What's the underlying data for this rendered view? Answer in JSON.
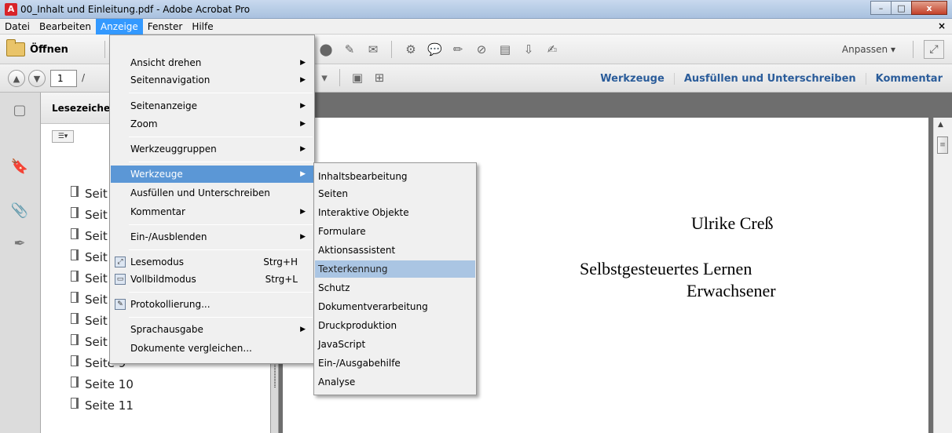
{
  "window": {
    "title": "00_Inhalt und Einleitung.pdf - Adobe Acrobat Pro",
    "minimize": "–",
    "maximize": "□",
    "close": "x"
  },
  "menubar": {
    "items": [
      "Datei",
      "Bearbeiten",
      "Anzeige",
      "Fenster",
      "Hilfe"
    ],
    "active": "Anzeige",
    "close_doc": "×"
  },
  "toolbar": {
    "open_label": "Öffnen",
    "anpassen_label": "Anpassen"
  },
  "navbar": {
    "page_value": "1",
    "page_of": "/",
    "right_links": [
      "Werkzeuge",
      "Ausfüllen und Unterschreiben",
      "Kommentar"
    ]
  },
  "panel": {
    "title": "Lesezeiche",
    "bookmarks": [
      "Seit",
      "Seit",
      "Seit",
      "Seit",
      "Seit",
      "Seit",
      "Seit",
      "Seit",
      "Seite 9",
      "Seite 10",
      "Seite 11"
    ]
  },
  "document": {
    "author": "Ulrike Creß",
    "title_line1": "Selbstgesteuertes Lernen",
    "title_line2": "Erwachsener"
  },
  "anzeige_menu": {
    "items": [
      {
        "label": "Ansicht drehen",
        "submenu": true
      },
      {
        "label": "Seitennavigation",
        "submenu": true
      },
      {
        "label": "Seitenanzeige",
        "submenu": true
      },
      {
        "label": "Zoom",
        "submenu": true
      },
      {
        "label": "Werkzeuggruppen",
        "submenu": true
      },
      {
        "label": "Werkzeuge",
        "submenu": true,
        "highlighted": true
      },
      {
        "label": "Ausfüllen und Unterschreiben",
        "submenu": false
      },
      {
        "label": "Kommentar",
        "submenu": true
      },
      {
        "label": "Ein-/Ausblenden",
        "submenu": true
      },
      {
        "label": "Lesemodus",
        "shortcut": "Strg+H"
      },
      {
        "label": "Vollbildmodus",
        "shortcut": "Strg+L"
      },
      {
        "label": "Protokollierung..."
      },
      {
        "label": "Sprachausgabe",
        "submenu": true
      },
      {
        "label": "Dokumente vergleichen..."
      }
    ]
  },
  "werkzeuge_menu": {
    "items": [
      "Inhaltsbearbeitung",
      "Seiten",
      "Interaktive Objekte",
      "Formulare",
      "Aktionsassistent",
      "Texterkennung",
      "Schutz",
      "Dokumentverarbeitung",
      "Druckproduktion",
      "JavaScript",
      "Ein-/Ausgabehilfe",
      "Analyse"
    ],
    "highlighted": "Texterkennung"
  }
}
